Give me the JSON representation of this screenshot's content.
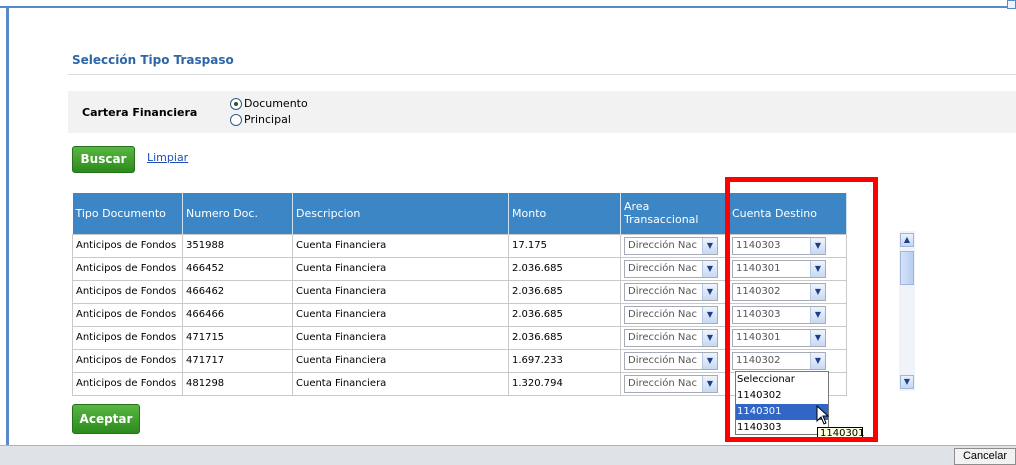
{
  "section": {
    "title": "Selección Tipo Traspaso"
  },
  "filter": {
    "label": "Cartera Financiera",
    "options": [
      {
        "label": "Documento",
        "selected": true
      },
      {
        "label": "Principal",
        "selected": false
      }
    ]
  },
  "actions": {
    "search_label": "Buscar",
    "clear_label": "Limpiar",
    "accept_label": "Aceptar",
    "cancel_label": "Cancelar"
  },
  "table": {
    "headers": [
      "Tipo Documento",
      "Numero Doc.",
      "Descripcion",
      "Monto",
      "Area Transaccional",
      "Cuenta Destino"
    ],
    "rows": [
      {
        "tipo": "Anticipos de Fondos",
        "numero": "351988",
        "descripcion": "Cuenta Financiera",
        "monto": "17.175",
        "area": "Dirección Nac",
        "cuenta": "1140303"
      },
      {
        "tipo": "Anticipos de Fondos",
        "numero": "466452",
        "descripcion": "Cuenta Financiera",
        "monto": "2.036.685",
        "area": "Dirección Nac",
        "cuenta": "1140301"
      },
      {
        "tipo": "Anticipos de Fondos",
        "numero": "466462",
        "descripcion": "Cuenta Financiera",
        "monto": "2.036.685",
        "area": "Dirección Nac",
        "cuenta": "1140302"
      },
      {
        "tipo": "Anticipos de Fondos",
        "numero": "466466",
        "descripcion": "Cuenta Financiera",
        "monto": "2.036.685",
        "area": "Dirección Nac",
        "cuenta": "1140303"
      },
      {
        "tipo": "Anticipos de Fondos",
        "numero": "471715",
        "descripcion": "Cuenta Financiera",
        "monto": "2.036.685",
        "area": "Dirección Nac",
        "cuenta": "1140301"
      },
      {
        "tipo": "Anticipos de Fondos",
        "numero": "471717",
        "descripcion": "Cuenta Financiera",
        "monto": "1.697.233",
        "area": "Dirección Nac",
        "cuenta": "1140302"
      },
      {
        "tipo": "Anticipos de Fondos",
        "numero": "481298",
        "descripcion": "Cuenta Financiera",
        "monto": "1.320.794",
        "area": "Dirección Nac",
        "cuenta": ""
      }
    ]
  },
  "dropdown": {
    "options": [
      "Seleccionar",
      "1140302",
      "1140301",
      "1140303"
    ],
    "highlighted": "1140301"
  },
  "tooltip": {
    "text": "1140301"
  },
  "colors": {
    "header_bg": "#3d86c6",
    "accent": "#2d66a8",
    "button_green": "#3a9a28",
    "highlight_red": "#ff0000"
  }
}
